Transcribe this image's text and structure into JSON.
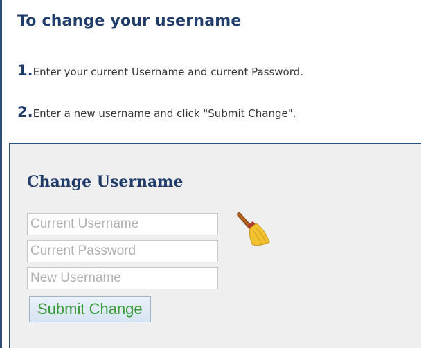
{
  "header": {
    "title": "To change your username"
  },
  "steps": [
    {
      "number": "1.",
      "text": "Enter your current Username and current Password."
    },
    {
      "number": "2.",
      "text": "Enter a new username and click \"Submit Change\"."
    }
  ],
  "form": {
    "title": "Change Username",
    "fields": [
      {
        "placeholder": "Current Username",
        "value": ""
      },
      {
        "placeholder": "Current Password",
        "value": ""
      },
      {
        "placeholder": "New Username",
        "value": ""
      }
    ],
    "submit_label": "Submit Change",
    "clear_icon": "broom-icon"
  },
  "colors": {
    "heading": "#1f3c6b",
    "panel_bg": "#efefef",
    "border": "#2e4f7a",
    "submit_text": "#3a9a3a"
  }
}
